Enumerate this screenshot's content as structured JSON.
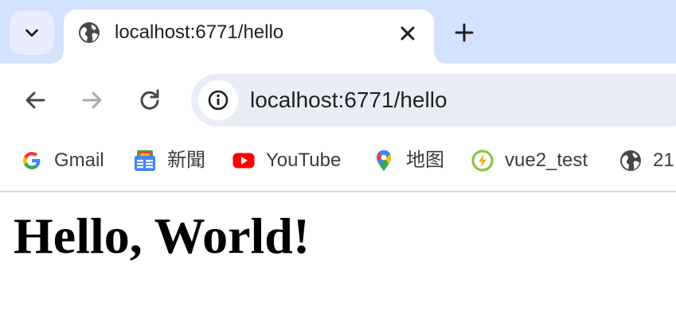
{
  "browser": {
    "tab": {
      "title": "localhost:6771/hello"
    },
    "address_bar": {
      "url": "localhost:6771/hello"
    },
    "bookmarks": [
      {
        "label": "Gmail",
        "icon": "gmail-icon"
      },
      {
        "label": "新聞",
        "icon": "google-news-icon"
      },
      {
        "label": "YouTube",
        "icon": "youtube-icon"
      },
      {
        "label": "地图",
        "icon": "google-maps-icon"
      },
      {
        "label": "vue2_test",
        "icon": "vue-bolt-icon"
      },
      {
        "label": "21",
        "icon": "globe-icon"
      }
    ]
  },
  "page": {
    "heading": "Hello, World!"
  },
  "colors": {
    "tabstrip": "#d3e3fd",
    "omnibox": "#e9eef6",
    "youtube": "#ff0000",
    "accent_blue": "#4285f4"
  }
}
